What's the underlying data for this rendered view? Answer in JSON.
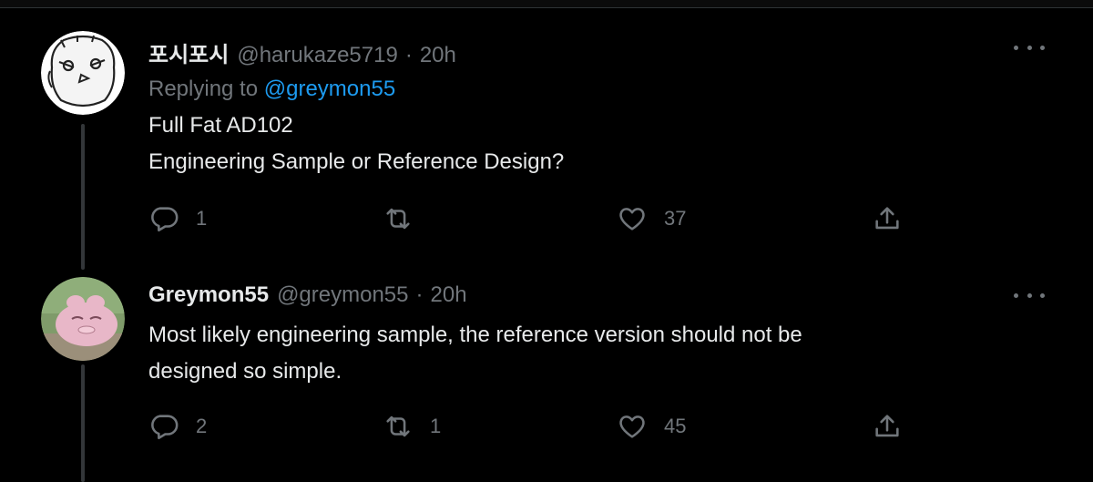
{
  "tweets": [
    {
      "display_name": "포시포시",
      "handle": "@harukaze5719",
      "separator": "·",
      "time": "20h",
      "replying_prefix": "Replying to",
      "replying_to": "@greymon55",
      "text_lines": [
        "Full Fat AD102",
        "Engineering Sample or Reference Design?"
      ],
      "actions": {
        "reply": "1",
        "retweet": "",
        "like": "37"
      }
    },
    {
      "display_name": "Greymon55",
      "handle": "@greymon55",
      "separator": "·",
      "time": "20h",
      "text_lines": [
        "Most likely engineering sample, the reference version should not be",
        "designed so simple."
      ],
      "actions": {
        "reply": "2",
        "retweet": "1",
        "like": "45"
      }
    }
  ],
  "icons": {
    "reply": "reply-icon",
    "retweet": "retweet-icon",
    "like": "heart-icon",
    "share": "share-icon",
    "more": "more-icon"
  },
  "colors": {
    "background": "#000000",
    "text": "#e7e9ea",
    "secondary": "#71767b",
    "link": "#1d9bf0"
  }
}
